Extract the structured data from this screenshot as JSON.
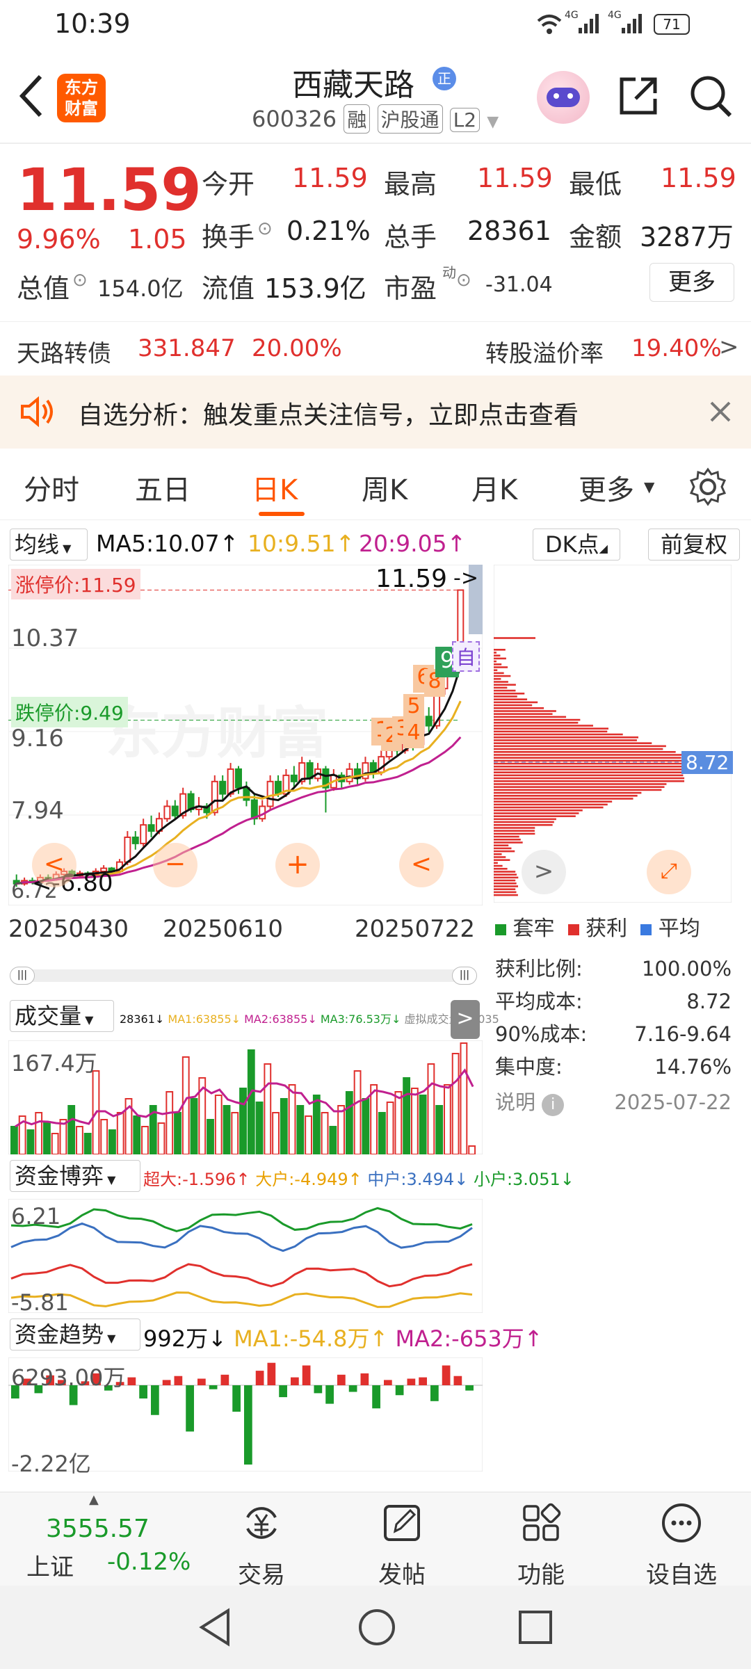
{
  "status": {
    "time": "10:39",
    "signal1": "4G",
    "signal2": "4G",
    "battery": "71"
  },
  "header": {
    "logo_line1": "东方",
    "logo_line2": "财富",
    "title": "西藏天路",
    "title_badge": "正",
    "code": "600326",
    "tag1": "融",
    "tag2": "沪股通",
    "tag3": "L2"
  },
  "quote": {
    "price": "11.59",
    "change_pct": "9.96%",
    "change": "1.05",
    "open_label": "今开",
    "open": "11.59",
    "high_label": "最高",
    "high": "11.59",
    "low_label": "最低",
    "low": "11.59",
    "turnover_label": "换手",
    "turnover": "0.21%",
    "volume_label": "总手",
    "volume": "28361",
    "amount_label": "金额",
    "amount": "3287万",
    "mktcap_label": "总值",
    "mktcap": "154.0亿",
    "float_label": "流值",
    "float": "153.9亿",
    "pe_label": "市盈",
    "pe_sup": "动",
    "pe": "-31.04",
    "more": "更多"
  },
  "convertible": {
    "name": "天路转债",
    "price": "331.847",
    "pct": "20.00%",
    "premium_label": "转股溢价率",
    "premium": "19.40%"
  },
  "alert": {
    "text": "自选分析：触发重点关注信号，立即点击查看"
  },
  "tabs": [
    "分时",
    "五日",
    "日K",
    "周K",
    "月K",
    "更多"
  ],
  "active_tab": "日K",
  "ma": {
    "selector": "均线",
    "ma5": "MA5:10.07↑",
    "ma10": "10:9.51↑",
    "ma20": "20:9.05↑",
    "dk": "DK点",
    "adjust": "前复权"
  },
  "kline": {
    "limit_up": "涨停价:11.59",
    "limit_down": "跌停价:9.49",
    "last_label": "11.59",
    "y_labels": [
      "10.37",
      "9.16",
      "7.94",
      "6.72"
    ],
    "low_label": "6.80",
    "dates": [
      "20250430",
      "20250610",
      "20250722"
    ],
    "markers": [
      "1",
      "2",
      "3",
      "4",
      "5",
      "6",
      "8",
      "9"
    ],
    "side_tag": "自",
    "watermark": "东方财富",
    "candles": [
      [
        6.9,
        6.85,
        7.0,
        6.8
      ],
      [
        6.85,
        6.9,
        6.95,
        6.82
      ],
      [
        6.9,
        6.88,
        6.95,
        6.84
      ],
      [
        6.88,
        6.95,
        7.0,
        6.86
      ],
      [
        6.95,
        6.92,
        7.0,
        6.88
      ],
      [
        6.92,
        7.0,
        7.05,
        6.9
      ],
      [
        7.0,
        7.05,
        7.1,
        6.98
      ],
      [
        7.05,
        6.98,
        7.08,
        6.95
      ],
      [
        6.98,
        7.02,
        7.06,
        6.95
      ],
      [
        7.02,
        7.0,
        7.05,
        6.96
      ],
      [
        7.0,
        7.05,
        7.1,
        6.98
      ],
      [
        7.05,
        7.1,
        7.15,
        7.0
      ],
      [
        7.1,
        7.05,
        7.12,
        7.0
      ],
      [
        7.05,
        7.2,
        7.25,
        7.02
      ],
      [
        7.2,
        7.6,
        7.7,
        7.15
      ],
      [
        7.6,
        7.5,
        7.7,
        7.4
      ],
      [
        7.5,
        7.8,
        7.9,
        7.45
      ],
      [
        7.8,
        7.7,
        7.95,
        7.6
      ],
      [
        7.7,
        7.9,
        8.0,
        7.65
      ],
      [
        7.9,
        8.1,
        8.2,
        7.85
      ],
      [
        8.1,
        7.95,
        8.2,
        7.9
      ],
      [
        7.95,
        8.3,
        8.4,
        7.9
      ],
      [
        8.3,
        8.05,
        8.35,
        8.0
      ],
      [
        8.05,
        8.1,
        8.25,
        7.95
      ],
      [
        8.1,
        8.0,
        8.15,
        7.9
      ],
      [
        8.0,
        8.5,
        8.6,
        7.95
      ],
      [
        8.5,
        8.3,
        8.6,
        8.2
      ],
      [
        8.3,
        8.7,
        8.8,
        8.25
      ],
      [
        8.7,
        8.4,
        8.75,
        8.3
      ],
      [
        8.4,
        8.2,
        8.5,
        8.1
      ],
      [
        8.2,
        7.9,
        8.3,
        7.8
      ],
      [
        7.9,
        8.1,
        8.2,
        7.85
      ],
      [
        8.1,
        8.5,
        8.6,
        8.05
      ],
      [
        8.5,
        8.3,
        8.6,
        8.25
      ],
      [
        8.3,
        8.6,
        8.7,
        8.25
      ],
      [
        8.6,
        8.5,
        8.75,
        8.4
      ],
      [
        8.5,
        8.8,
        8.9,
        8.45
      ],
      [
        8.8,
        8.55,
        8.85,
        8.45
      ],
      [
        8.55,
        8.7,
        8.8,
        8.5
      ],
      [
        8.7,
        8.4,
        8.75,
        8.0
      ],
      [
        8.4,
        8.6,
        8.7,
        8.35
      ],
      [
        8.6,
        8.5,
        8.65,
        8.4
      ],
      [
        8.5,
        8.7,
        8.8,
        8.45
      ],
      [
        8.7,
        8.55,
        8.8,
        8.45
      ],
      [
        8.55,
        8.8,
        8.9,
        8.5
      ],
      [
        8.8,
        8.65,
        8.85,
        8.55
      ],
      [
        8.65,
        8.9,
        9.0,
        8.6
      ],
      [
        8.9,
        9.2,
        9.3,
        8.85
      ],
      [
        9.2,
        9.0,
        9.35,
        8.9
      ],
      [
        9.0,
        9.3,
        9.4,
        8.95
      ],
      [
        9.3,
        9.1,
        9.4,
        9.0
      ],
      [
        9.1,
        9.55,
        9.6,
        9.05
      ],
      [
        9.55,
        9.4,
        9.7,
        9.3
      ],
      [
        9.4,
        10.0,
        10.1,
        9.35
      ],
      [
        10.0,
        10.3,
        10.4,
        9.9
      ],
      [
        10.3,
        10.54,
        10.6,
        10.2
      ],
      [
        10.54,
        11.59,
        11.59,
        10.5
      ]
    ]
  },
  "chips": {
    "price_tag": "8.72",
    "legend": [
      "套牢",
      "获利",
      "平均"
    ],
    "rows": [
      {
        "label": "获利比例:",
        "value": "100.00%"
      },
      {
        "label": "平均成本:",
        "value": "8.72"
      },
      {
        "label": "90%成本:",
        "value": "7.16-9.64"
      },
      {
        "label": "集中度:",
        "value": "14.76%"
      }
    ],
    "note_label": "说明",
    "note_date": "2025-07-22"
  },
  "volume": {
    "selector": "成交量",
    "v": "28361↓",
    "ma1": "MA1:63855↓",
    "ma2": "MA2:63855↓",
    "ma3": "MA3:76.53万↓",
    "virtual": "虚拟成交量:39035",
    "max_label": "167.4万"
  },
  "capital_game": {
    "selector": "资金博弈",
    "super": "超大:-1.596↑",
    "large": "大户:-4.949↑",
    "mid": "中户:3.494↓",
    "small": "小户:3.051↓",
    "max_label": "6.21",
    "min_label": "-5.81"
  },
  "capital_trend": {
    "selector": "资金趋势",
    "value": "992万↓",
    "ma1": "MA1:-54.8万↑",
    "ma2": "MA2:-653万↑",
    "max_label": "6293.00万",
    "min_label": "-2.22亿"
  },
  "bottomnav": {
    "index_value": "3555.57",
    "index_name": "上证",
    "index_change": "-0.12%",
    "items": [
      "交易",
      "发帖",
      "功能",
      "设自选"
    ]
  },
  "colors": {
    "up": "#e0302d",
    "down": "#1a9a2a",
    "ma5": "#111111",
    "ma10": "#e8b020",
    "ma20": "#c0208f",
    "accent": "#ff5500"
  }
}
